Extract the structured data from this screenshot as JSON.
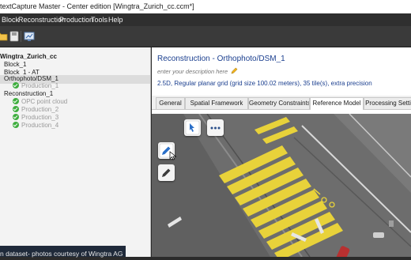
{
  "window": {
    "title": "textCapture Master - Center edition [Wingtra_Zurich_cc.ccm*]"
  },
  "menu": {
    "items": [
      "Block",
      "Reconstruction",
      "Production",
      "Tools",
      "Help"
    ]
  },
  "toolbar": {
    "buttons": [
      "folder-icon",
      "save-icon",
      "monitor-icon"
    ]
  },
  "tree": {
    "root": "Wingtra_Zurich_cc",
    "block": "Block_1",
    "block_at": "Block_1 - AT",
    "ortho": "Orthophoto/DSM_1",
    "ortho_production": "Production_1",
    "reconstruction": "Reconstruction_1",
    "opc": "OPC point cloud",
    "production_2": "Production_2",
    "production_3": "Production_3",
    "production_4": "Production_4"
  },
  "caption": "n dataset- photos courtesy of Wingtra AG",
  "panel": {
    "title": "Reconstruction - Orthophoto/DSM_1",
    "description_placeholder": "enter your description here",
    "info": "2.5D, Regular planar grid (grid size 100.02 meters), 35 tile(s), extra precision"
  },
  "tabs": [
    "General",
    "Spatial Framework",
    "Geometry Constraints",
    "Reference Model",
    "Processing Setti"
  ],
  "active_tab": "Reference Model",
  "colors": {
    "title_blue": "#1b3f8f",
    "menubar": "#2f2f2f",
    "check_green": "#3fae3f",
    "crosswalk_yellow": "#e8d23a"
  }
}
